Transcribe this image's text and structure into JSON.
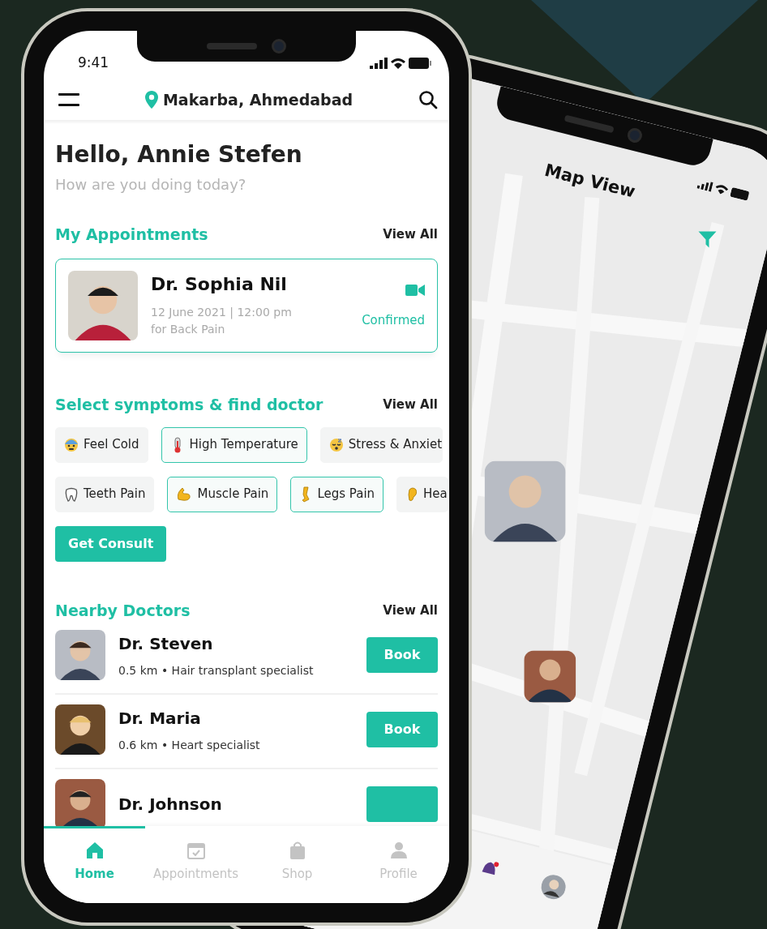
{
  "status_bar": {
    "time": "9:41"
  },
  "header": {
    "location": "Makarba, Ahmedabad"
  },
  "greeting": {
    "title": "Hello, Annie Stefen",
    "subtitle": "How are you doing today?"
  },
  "appointments": {
    "title": "My Appointments",
    "view_all": "View All",
    "items": [
      {
        "doctor": "Dr. Sophia Nil",
        "datetime": "12 June 2021 | 12:00 pm",
        "reason": "for Back Pain",
        "status": "Confirmed"
      }
    ]
  },
  "symptoms": {
    "title": "Select symptoms & find doctor",
    "view_all": "View All",
    "rows": [
      [
        {
          "label": "Feel Cold",
          "selected": false
        },
        {
          "label": "High Temperature",
          "selected": true
        },
        {
          "label": "Stress & Anxiet",
          "selected": false
        }
      ],
      [
        {
          "label": "Teeth Pain",
          "selected": false
        },
        {
          "label": "Muscle Pain",
          "selected": true
        },
        {
          "label": "Legs Pain",
          "selected": true
        },
        {
          "label": "Hea",
          "selected": false
        }
      ]
    ],
    "button": "Get Consult"
  },
  "nearby": {
    "title": "Nearby Doctors",
    "view_all": "View All",
    "doctors": [
      {
        "name": "Dr. Steven",
        "info": "0.5 km • Hair transplant specialist",
        "button": "Book"
      },
      {
        "name": "Dr. Maria",
        "info": "0.6 km • Heart specialist",
        "button": "Book"
      },
      {
        "name": "Dr. Johnson"
      }
    ]
  },
  "tabs": [
    {
      "label": "Home",
      "selected": true
    },
    {
      "label": "Appointments",
      "selected": false
    },
    {
      "label": "Shop",
      "selected": false
    },
    {
      "label": "Profile",
      "selected": false
    }
  ],
  "map_screen": {
    "title": "Map View"
  }
}
